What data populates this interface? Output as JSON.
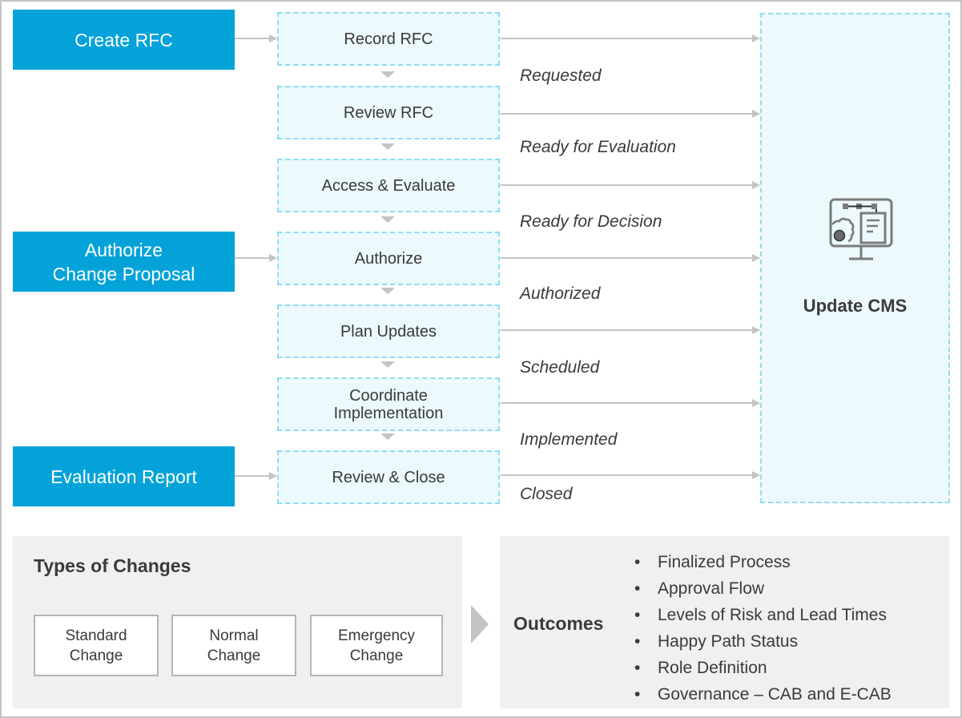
{
  "diagram": {
    "actors": [
      {
        "id": "create-rfc",
        "label": "Create RFC"
      },
      {
        "id": "authorize-change-proposal",
        "label": "Authorize\nChange Proposal"
      },
      {
        "id": "evaluation-report",
        "label": "Evaluation Report"
      }
    ],
    "steps": [
      {
        "label": "Record RFC"
      },
      {
        "label": "Review RFC"
      },
      {
        "label": "Access & Evaluate"
      },
      {
        "label": "Authorize"
      },
      {
        "label": "Plan Updates"
      },
      {
        "label": "Coordinate\nImplementation"
      },
      {
        "label": "Review & Close"
      }
    ],
    "statuses": [
      {
        "label": "Requested"
      },
      {
        "label": "Ready for Evaluation"
      },
      {
        "label": "Ready for Decision"
      },
      {
        "label": "Authorized"
      },
      {
        "label": "Scheduled"
      },
      {
        "label": "Implemented"
      },
      {
        "label": "Closed"
      }
    ],
    "target": {
      "label": "Update CMS",
      "icon": "computer-config-icon"
    },
    "colors": {
      "accent": "#03a3d9",
      "step_fill": "#ecf9fd",
      "step_border": "#8fdcf3",
      "arrow": "#c4c4c4",
      "panel": "#f0f0f0"
    }
  },
  "types_of_changes": {
    "title": "Types of Changes",
    "items": [
      {
        "label": "Standard\nChange"
      },
      {
        "label": "Normal\nChange"
      },
      {
        "label": "Emergency\nChange"
      }
    ]
  },
  "outcomes": {
    "title": "Outcomes",
    "items": [
      "Finalized Process",
      "Approval Flow",
      "Levels of Risk and Lead Times",
      "Happy Path Status",
      "Role Definition",
      "Governance – CAB and E-CAB"
    ]
  }
}
